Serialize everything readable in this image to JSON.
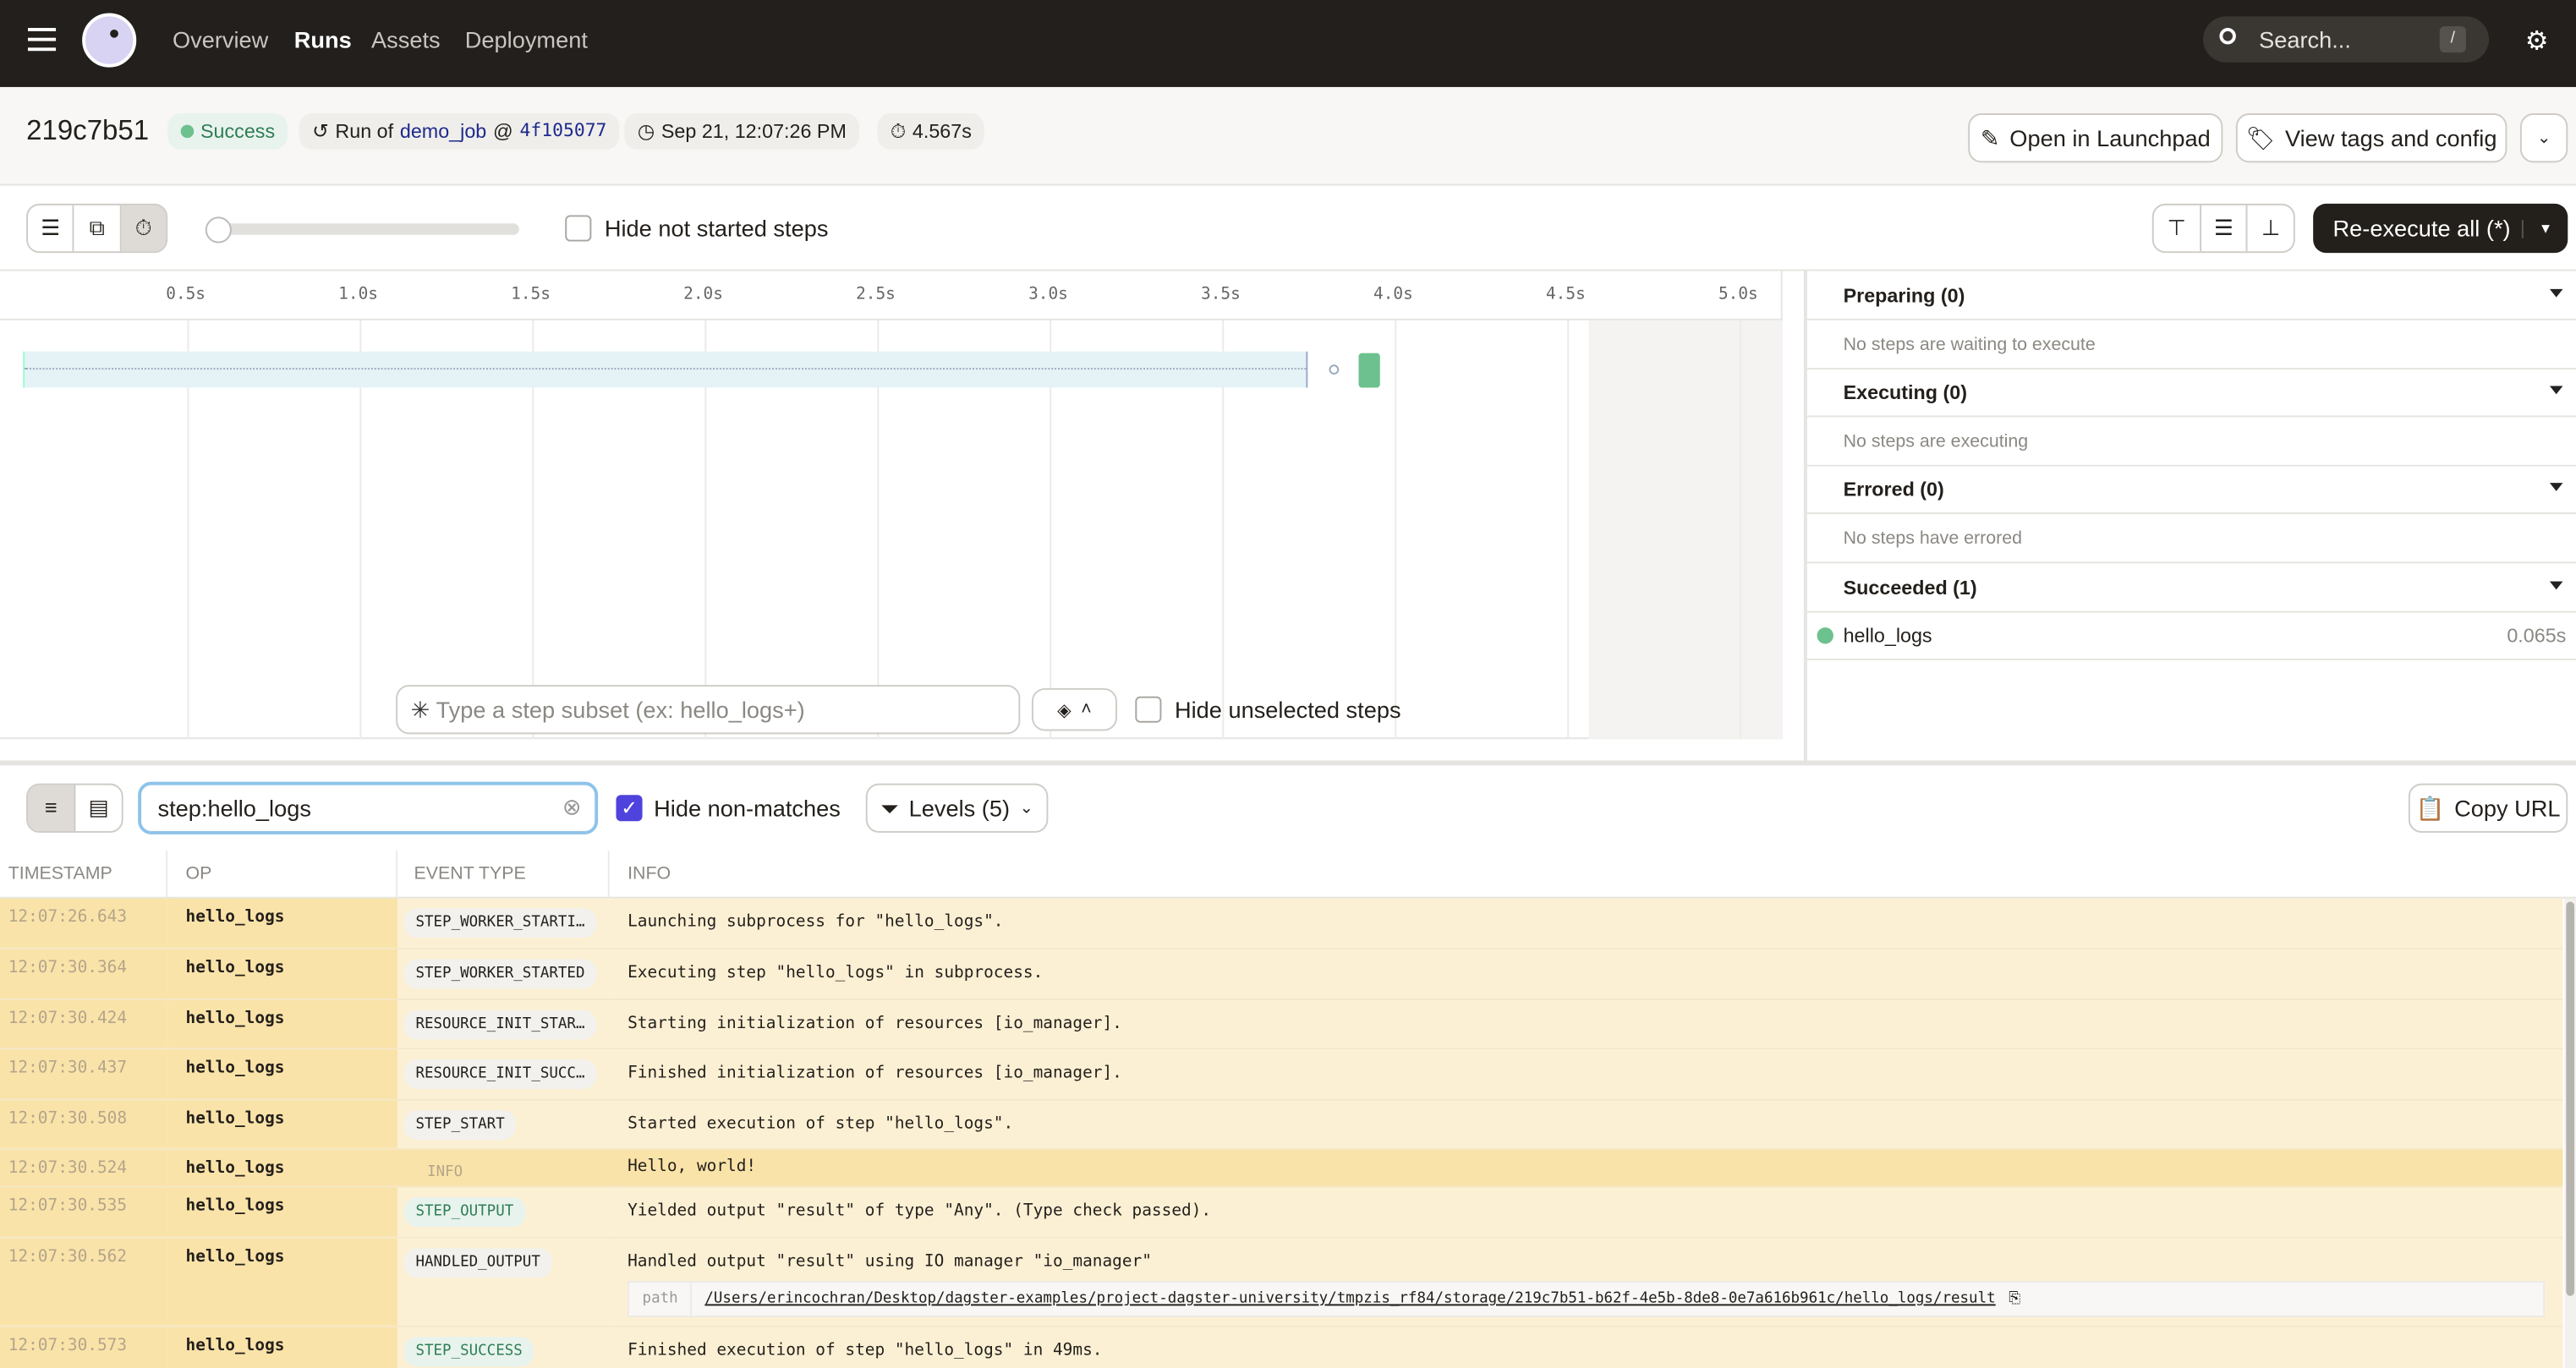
{
  "nav": {
    "items": [
      "Overview",
      "Runs",
      "Assets",
      "Deployment"
    ],
    "active": "Runs",
    "search_placeholder": "Search...",
    "search_shortcut": "/"
  },
  "run": {
    "id": "219c7b51",
    "status": "Success",
    "run_of_prefix": "Run of",
    "job": "demo_job",
    "at": "@",
    "snapshot": "4f105077",
    "started": "Sep 21, 12:07:26 PM",
    "duration": "4.567s"
  },
  "actions": {
    "launchpad": "Open in Launchpad",
    "tags": "View tags and config",
    "reexecute": "Re-execute all (*)"
  },
  "toolbar": {
    "hide_not_started": "Hide not started steps",
    "step_subset_placeholder": "Type a step subset (ex: hello_logs+)",
    "hide_unselected": "Hide unselected steps"
  },
  "gantt": {
    "ticks": [
      "0.5s",
      "1.0s",
      "1.5s",
      "2.0s",
      "2.5s",
      "3.0s",
      "3.5s",
      "4.0s",
      "4.5s",
      "5.0s"
    ]
  },
  "status_panel": {
    "sections": [
      {
        "title": "Preparing (0)",
        "empty": "No steps are waiting to execute"
      },
      {
        "title": "Executing (0)",
        "empty": "No steps are executing"
      },
      {
        "title": "Errored (0)",
        "empty": "No steps have errored"
      },
      {
        "title": "Succeeded (1)",
        "step": "hello_logs",
        "time": "0.065s"
      }
    ]
  },
  "logs": {
    "filter": "step:hello_logs",
    "hide_non_matches": "Hide non-matches",
    "hide_non_matches_checked": true,
    "levels": "Levels (5)",
    "copy_url": "Copy URL",
    "columns": [
      "TIMESTAMP",
      "OP",
      "EVENT TYPE",
      "INFO"
    ],
    "rows": [
      {
        "ts": "12:07:26.643",
        "op": "hello_logs",
        "event": "STEP_WORKER_STARTI…",
        "info": "Launching subprocess for \"hello_logs\"."
      },
      {
        "ts": "12:07:30.364",
        "op": "hello_logs",
        "event": "STEP_WORKER_STARTED",
        "info": "Executing step \"hello_logs\" in subprocess."
      },
      {
        "ts": "12:07:30.424",
        "op": "hello_logs",
        "event": "RESOURCE_INIT_STAR…",
        "info": "Starting initialization of resources [io_manager]."
      },
      {
        "ts": "12:07:30.437",
        "op": "hello_logs",
        "event": "RESOURCE_INIT_SUCC…",
        "info": "Finished initialization of resources [io_manager]."
      },
      {
        "ts": "12:07:30.508",
        "op": "hello_logs",
        "event": "STEP_START",
        "info": "Started execution of step \"hello_logs\"."
      },
      {
        "ts": "12:07:30.524",
        "op": "hello_logs",
        "event": "INFO",
        "info": "Hello, world!"
      },
      {
        "ts": "12:07:30.535",
        "op": "hello_logs",
        "event": "STEP_OUTPUT",
        "info": "Yielded output \"result\" of type \"Any\". (Type check passed)."
      },
      {
        "ts": "12:07:30.562",
        "op": "hello_logs",
        "event": "HANDLED_OUTPUT",
        "info": "Handled output \"result\" using IO manager \"io_manager\"",
        "meta_key": "path",
        "meta_value": "/Users/erincochran/Desktop/dagster-examples/project-dagster-university/tmpzis_rf84/storage/219c7b51-b62f-4e5b-8de8-0e7a616b961c/hello_logs/result"
      },
      {
        "ts": "12:07:30.573",
        "op": "hello_logs",
        "event": "STEP_SUCCESS",
        "info": "Finished execution of step \"hello_logs\" in 49ms."
      }
    ]
  },
  "colors": {
    "nav_bg": "#221f1c",
    "success": "#6cc18e",
    "log_highlight": "#fae3a9",
    "log_row": "#fcf0d4",
    "accent": "#4f43dd"
  }
}
